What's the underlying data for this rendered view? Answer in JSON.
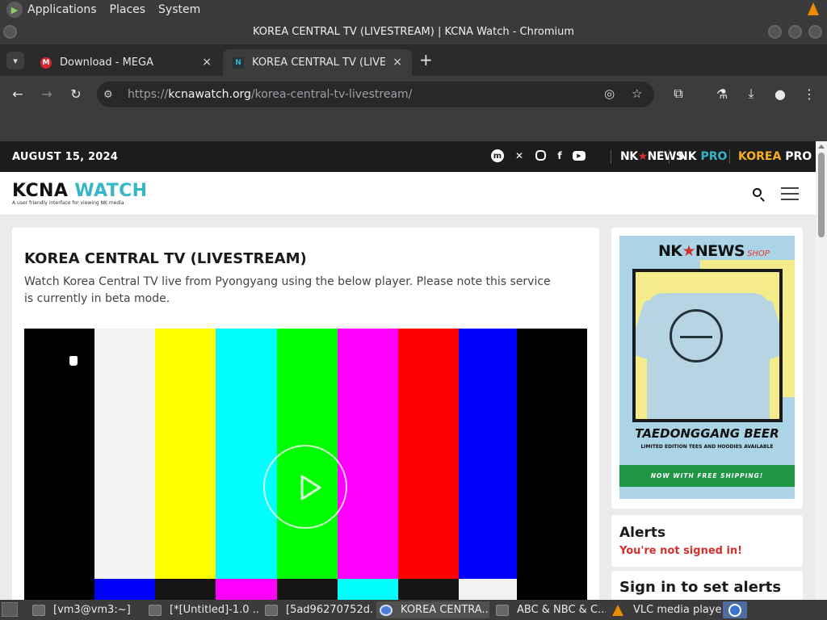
{
  "panel": {
    "menus": [
      "Applications",
      "Places",
      "System"
    ]
  },
  "window": {
    "title": "KOREA CENTRAL TV (LIVESTREAM) | KCNA Watch - Chromium"
  },
  "tabs": [
    {
      "title": "Download - MEGA",
      "favicon": "M",
      "close": "×"
    },
    {
      "title": "KOREA CENTRAL TV (LIVESTREAM) | KCNA Watch",
      "favicon": "N",
      "close": "×"
    }
  ],
  "toolbar": {
    "url_scheme": "https://",
    "url_host": "kcnawatch.org",
    "url_path": "/korea-central-tv-livestream/"
  },
  "site": {
    "date": "AUGUST 15, 2024",
    "nav_links": {
      "nknews_a": "NK",
      "nknews_star": "★",
      "nknews_b": "NEWS",
      "nkpro_a": "NK",
      "nkpro_b": "PRO",
      "koreapro_a": "KOREA",
      "koreapro_b": "PRO"
    },
    "logo_a": "KCNA",
    "logo_b": "WATCH",
    "logo_tagline": "A user friendly interface for viewing NK media"
  },
  "article": {
    "title": "KOREA CENTRAL TV (LIVESTREAM)",
    "description": "Watch Korea Central TV live from Pyongyang using the below player. Please note this service is currently in beta mode."
  },
  "player": {
    "color_bars_top": [
      "#000000",
      "#f2f2f2",
      "#ffff00",
      "#00ffff",
      "#00ff00",
      "#ff00ff",
      "#ff0000",
      "#0000ff",
      "#000000"
    ],
    "color_bars_bottom": [
      "#000000",
      "#0000ff",
      "#141414",
      "#ff00ff",
      "#141414",
      "#00ffff",
      "#141414",
      "#f2f2f2",
      "#000000"
    ]
  },
  "sidebar": {
    "ad": {
      "brand_a": "NK",
      "brand_star": "★",
      "brand_b": "NEWS",
      "brand_shop": "SHOP",
      "headline": "TAEDONGGANG BEER",
      "subline": "LIMITED EDITION TEES AND HOODIES AVAILABLE",
      "banner": "NOW WITH FREE SHIPPING!"
    },
    "alerts_title": "Alerts",
    "alerts_status": "You're not signed in!",
    "signin_title": "Sign in to set alerts"
  },
  "taskbar": {
    "items": [
      "[vm3@vm3:~]",
      "[*[Untitled]-1.0 ...",
      "[5ad96270752d...",
      "KOREA CENTRA...",
      "ABC & NBC & C...",
      "VLC media player"
    ]
  },
  "colors": {
    "accent_teal": "#36b6c6",
    "alert_red": "#d32f2f",
    "korea_pro_yellow": "#f5b024",
    "shop_green": "#1e9645"
  }
}
